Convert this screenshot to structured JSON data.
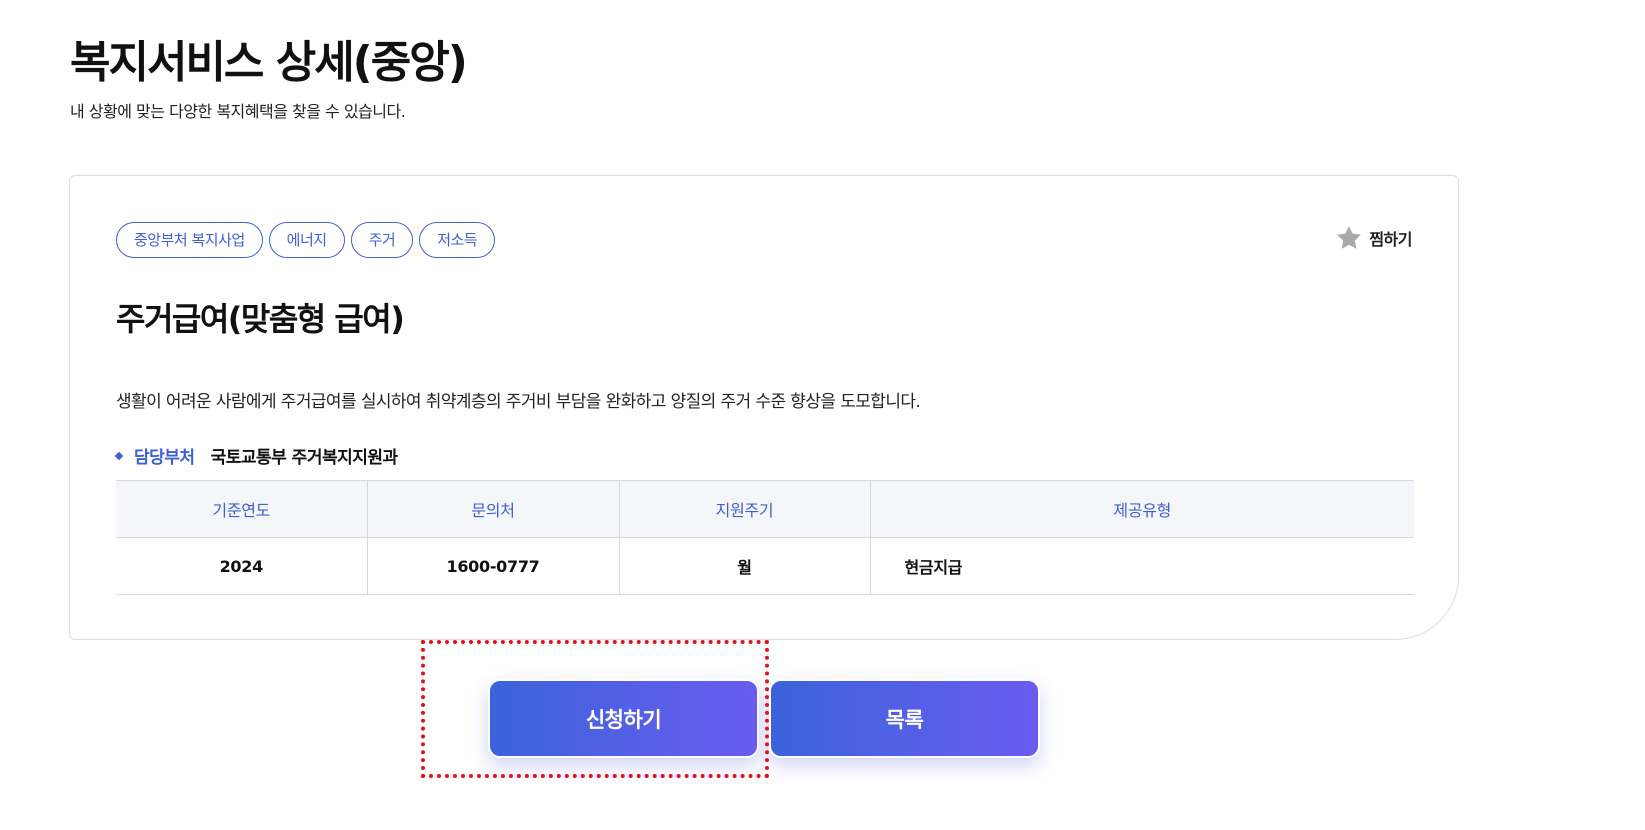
{
  "page": {
    "title": "복지서비스 상세(중앙)",
    "subtitle": "내 상황에 맞는 다양한 복지혜택을 찾을 수 있습니다."
  },
  "service": {
    "tags": [
      "중앙부처 복지사업",
      "에너지",
      "주거",
      "저소득"
    ],
    "favorite_label": "찜하기",
    "favorite_icon": "star-icon",
    "title": "주거급여(맞춤형 급여)",
    "description": "생활이 어려운 사람에게 주거급여를 실시하여 취약계층의 주거비 부담을 완화하고 양질의 주거 수준 향상을 도모합니다.",
    "department_label": "담당부처",
    "department": "국토교통부 주거복지지원과"
  },
  "info_table": {
    "headers": [
      "기준연도",
      "문의처",
      "지원주기",
      "제공유형"
    ],
    "row": [
      "2024",
      "1600-0777",
      "월",
      "현금지급"
    ]
  },
  "actions": {
    "apply_label": "신청하기",
    "list_label": "목록"
  },
  "colors": {
    "accent": "#3f5fd4",
    "button_gradient_start": "#3b63db",
    "button_gradient_end": "#6a5cf0",
    "highlight": "#e0141e",
    "star": "#a9a9a9"
  }
}
